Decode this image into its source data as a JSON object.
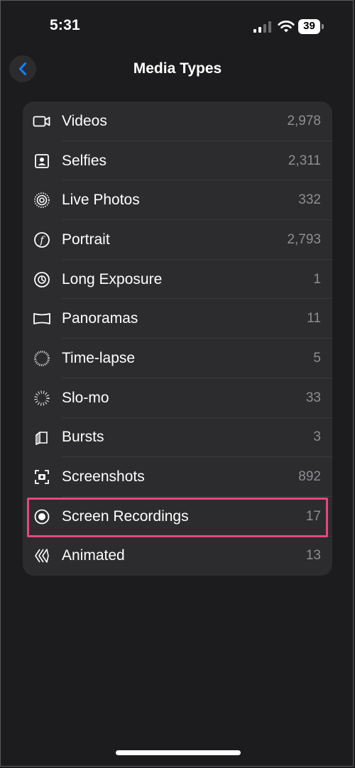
{
  "status_bar": {
    "time": "5:31",
    "battery": "39"
  },
  "nav": {
    "title": "Media Types"
  },
  "items": [
    {
      "label": "Videos",
      "count": "2,978",
      "icon": "video-icon"
    },
    {
      "label": "Selfies",
      "count": "2,311",
      "icon": "selfie-icon"
    },
    {
      "label": "Live Photos",
      "count": "332",
      "icon": "live-photo-icon"
    },
    {
      "label": "Portrait",
      "count": "2,793",
      "icon": "portrait-icon"
    },
    {
      "label": "Long Exposure",
      "count": "1",
      "icon": "long-exposure-icon"
    },
    {
      "label": "Panoramas",
      "count": "11",
      "icon": "panorama-icon"
    },
    {
      "label": "Time-lapse",
      "count": "5",
      "icon": "time-lapse-icon"
    },
    {
      "label": "Slo-mo",
      "count": "33",
      "icon": "slo-mo-icon"
    },
    {
      "label": "Bursts",
      "count": "3",
      "icon": "bursts-icon"
    },
    {
      "label": "Screenshots",
      "count": "892",
      "icon": "screenshot-icon"
    },
    {
      "label": "Screen Recordings",
      "count": "17",
      "icon": "screen-recording-icon"
    },
    {
      "label": "Animated",
      "count": "13",
      "icon": "animated-icon"
    }
  ],
  "colors": {
    "background": "#1c1c1e",
    "card": "#2c2c2e",
    "accent": "#0a84ff",
    "highlight": "#e8467c",
    "secondary_text": "#8e8e93"
  }
}
